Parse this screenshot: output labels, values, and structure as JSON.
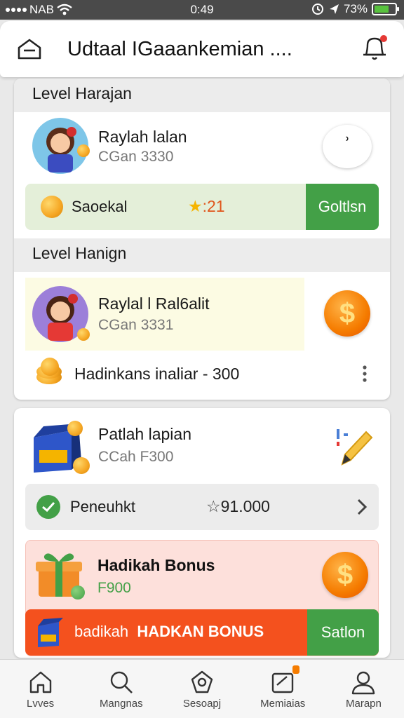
{
  "status_bar": {
    "carrier": "NAB",
    "time": "0:49",
    "battery_pct": "73%",
    "battery_level": 0.73
  },
  "header": {
    "title": "Udtaal IGaaankemian ....",
    "home_icon": "home-icon",
    "bell_icon": "bell-icon"
  },
  "card1": {
    "section_title": "Level Harajan",
    "name": "Raylah lalan",
    "sub": "CGan 3330",
    "badge": "ʾ",
    "pill_label": "Saoekal",
    "pill_stars": ":21",
    "pill_button": "Goltlsn",
    "section2_title": "Level Hanign",
    "name2": "Raylal l Ral6alit",
    "sub2": "CGan 3331",
    "reward_text": "Hadinkans inaliar - 300"
  },
  "card2": {
    "name": "Patlah lapian",
    "sub": "CCah F300",
    "check_label": "Peneuhkt",
    "check_value": "91.000",
    "bonus_title": "Hadikah Bonus",
    "bonus_sub": "F900",
    "banner_prefix": "badikah",
    "banner_text": "HADKAN BONUS",
    "banner_button": "Satlon"
  },
  "nav": {
    "items": [
      {
        "label": "Lvves",
        "icon": "home-icon"
      },
      {
        "label": "Mangnas",
        "icon": "search-icon"
      },
      {
        "label": "Sesoapj",
        "icon": "tag-icon"
      },
      {
        "label": "Memiaias",
        "icon": "notes-icon"
      },
      {
        "label": "Marapn",
        "icon": "profile-icon"
      }
    ]
  },
  "colors": {
    "accent_green": "#43a047",
    "bonus_red": "#f4511e",
    "coin_orange": "#f57c00"
  }
}
